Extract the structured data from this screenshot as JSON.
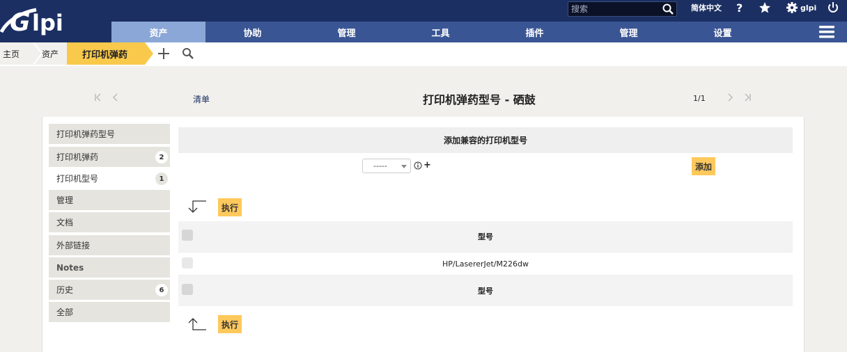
{
  "header": {
    "logo_text": "Glpi",
    "search_placeholder": "搜索",
    "language": "简体中文",
    "user": "glpi",
    "colors": {
      "header_bg": "#1b2f62",
      "menu_bg": "#3a5593",
      "menu_active": "#8ba7d7",
      "accent": "#f9c94b"
    }
  },
  "menu": [
    {
      "label": "资产",
      "active": true
    },
    {
      "label": "协助"
    },
    {
      "label": "管理"
    },
    {
      "label": "工具"
    },
    {
      "label": "插件"
    },
    {
      "label": "管理"
    },
    {
      "label": "设置"
    }
  ],
  "breadcrumb": {
    "home": "主页",
    "assets": "资产",
    "current": "打印机弹药"
  },
  "title_row": {
    "list_link": "清单",
    "title": "打印机弹药型号 - 硒鼓",
    "pager": "1/1"
  },
  "tabs": [
    {
      "label": "打印机弹药型号"
    },
    {
      "label": "打印机弹药",
      "badge": "2"
    },
    {
      "label": "打印机型号",
      "badge": "1",
      "active": true
    },
    {
      "label": "管理"
    },
    {
      "label": "文档"
    },
    {
      "label": "外部链接"
    },
    {
      "label": "Notes"
    },
    {
      "label": "历史",
      "badge": "6"
    },
    {
      "label": "全部"
    }
  ],
  "form": {
    "section_title": "添加兼容的打印机型号",
    "select_value": "-----",
    "add_button": "添加"
  },
  "actions": {
    "execute_top": "执行",
    "execute_bottom": "执行"
  },
  "table": {
    "header": "型号",
    "rows": [
      "HP/LasererJet/M226dw"
    ],
    "footer": "型号"
  }
}
